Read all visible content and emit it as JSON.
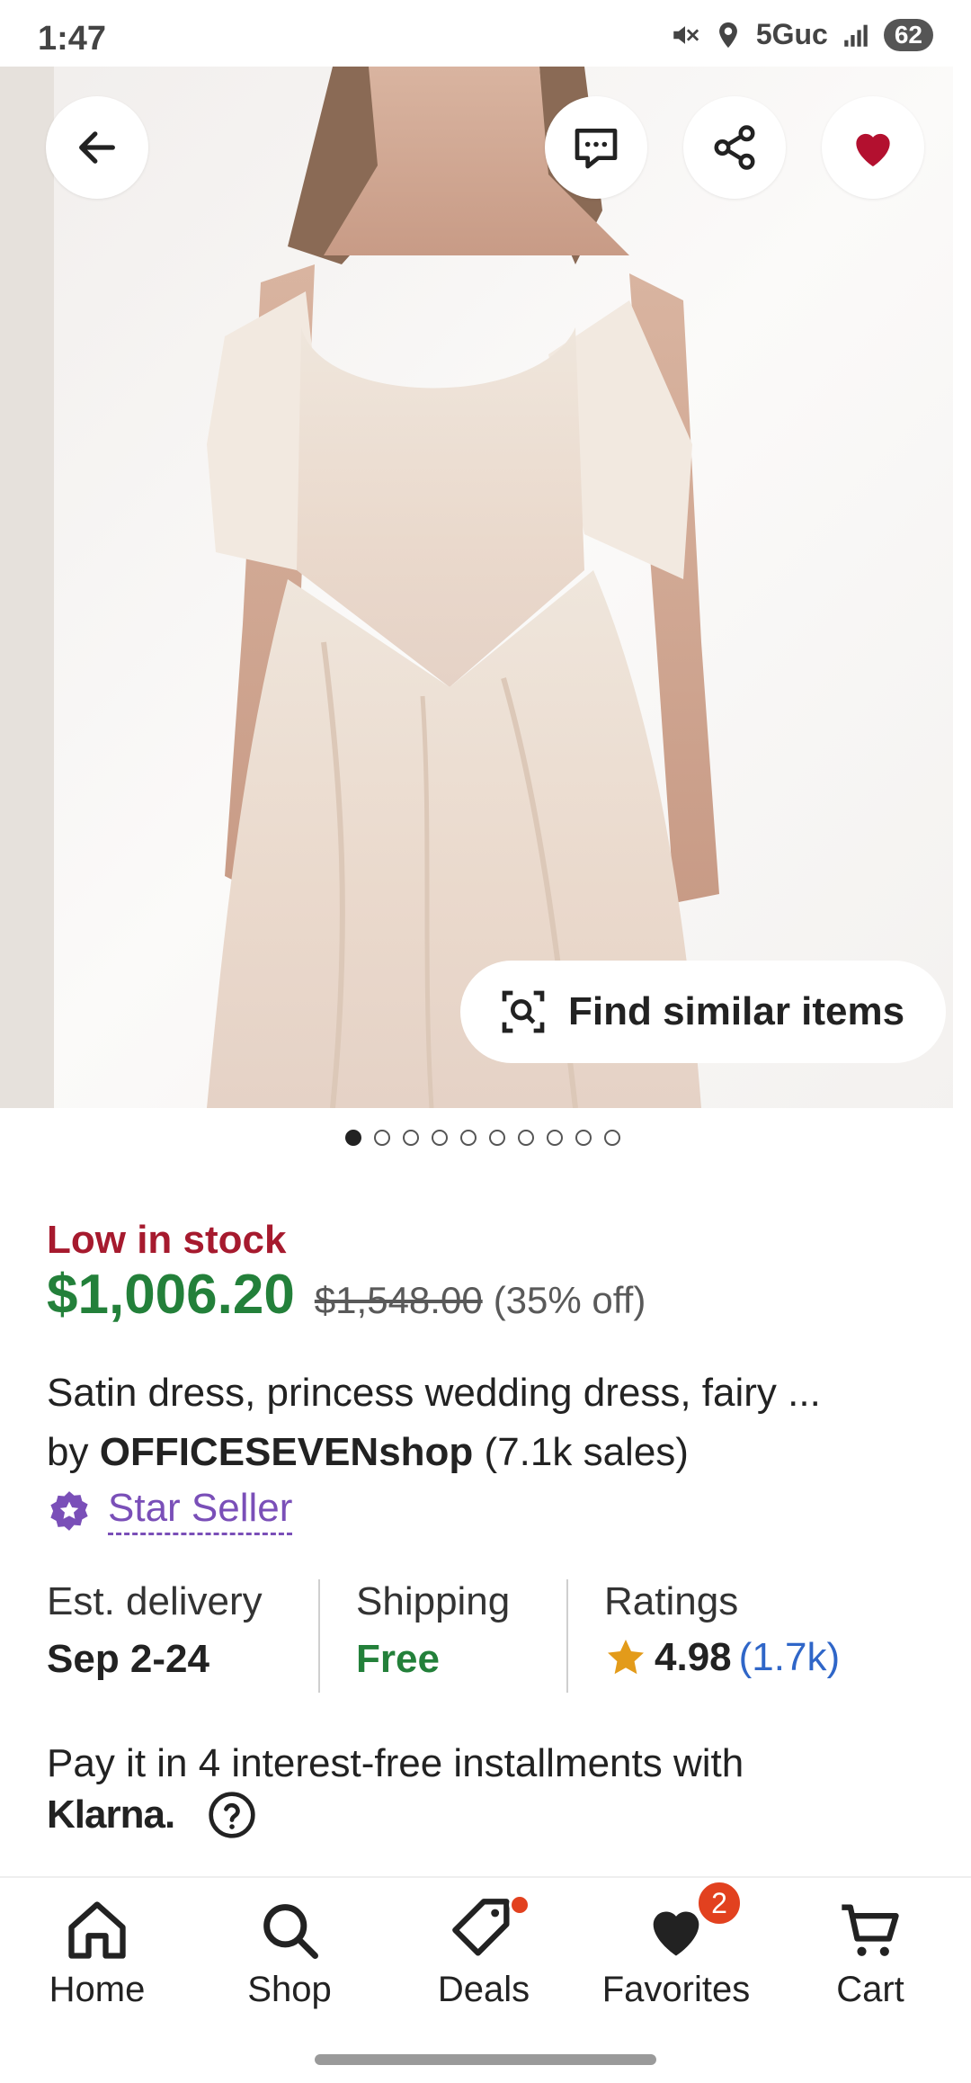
{
  "status_bar": {
    "time": "1:47",
    "network": "5Guc",
    "battery": "62"
  },
  "hero": {
    "image_alt": "Satin dress product photo",
    "find_similar_label": "Find similar items",
    "dot_count": 10,
    "active_dot": 0
  },
  "listing": {
    "stock_label": "Low in stock",
    "price_now": "$1,006.20",
    "price_original": "$1,548.00",
    "discount": "(35% off)",
    "title": "Satin dress, princess wedding dress, fairy ...",
    "seller_prefix": "by",
    "seller_name": "OFFICESEVENshop",
    "seller_sales": "(7.1k sales)",
    "star_seller_label": "Star Seller"
  },
  "info": {
    "delivery_label": "Est. delivery",
    "delivery_value": "Sep 2-24",
    "shipping_label": "Shipping",
    "shipping_value": "Free",
    "ratings_label": "Ratings",
    "rating_value": "4.98",
    "rating_count": "(1.7k)"
  },
  "klarna": {
    "text": "Pay it in 4 interest-free installments with",
    "logo": "Klarna."
  },
  "nav": {
    "home": "Home",
    "shop": "Shop",
    "deals": "Deals",
    "favorites": "Favorites",
    "favorites_badge": "2",
    "cart": "Cart"
  },
  "colors": {
    "sale_green": "#23803a",
    "stock_red": "#a61a2e",
    "star_seller_purple": "#7a4fb8",
    "rating_link_blue": "#2f66c8",
    "favorite_red": "#b3102f",
    "badge_orange": "#e2411f"
  }
}
